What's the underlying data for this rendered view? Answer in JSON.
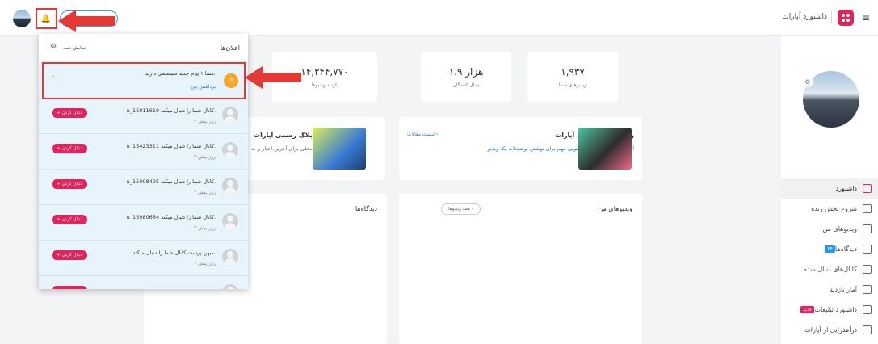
{
  "header": {
    "brand_title": "داشبورد آپارات",
    "menu_icon": "hamburger-icon",
    "logo_icon": "aparat-logo-icon",
    "bell_icon": "bell-icon"
  },
  "stats": [
    {
      "value": "۱,۹۳۷",
      "label": "ویدیوهای شما",
      "icon": "video-icon"
    },
    {
      "value": "۱.۹ هزار",
      "label": "دنبال کنندگان",
      "icon": "users-icon"
    },
    {
      "value": "۱۴,۲۴۴,۷۷۰",
      "label": "بازدید ویدیوها",
      "icon": "views-icon"
    }
  ],
  "blogs": [
    {
      "title": "وبلاگ تیم محصول آپارات",
      "desc": "آخرین مطلب: چند نکته ستونی مهم برای نوشتن توضیحات یک ویدیو",
      "link": "لیست مقالات ›"
    },
    {
      "title": "بلاگ رسمی آپارات",
      "desc": "محلی برای آخرین اخبار و ت"
    }
  ],
  "panels": {
    "my_videos_title": "ویدیوهای من",
    "all_videos_chip": "همه ویدیوها ›",
    "comments_title": "دیدگاه‌ها"
  },
  "sidebar": {
    "items": [
      {
        "label": "داشبورد",
        "active": true
      },
      {
        "label": "شروع پخش زنده"
      },
      {
        "label": "ویدیوهای من"
      },
      {
        "label": "دیدگاه‌ها",
        "badge": "۲۴"
      },
      {
        "label": "کانال‌های دنبال شده"
      },
      {
        "label": "آمار بازدید"
      },
      {
        "label": "داشبورد تبلیغات",
        "badge": "جدید"
      },
      {
        "label": "درآمدزایی از آپارات"
      }
    ]
  },
  "notifications": {
    "title": "اعلان‌ها",
    "show_all": "نمایش همه",
    "system": {
      "text": "شما ۱ پیام جدید سیستمی دارید.",
      "action": "برداشتن پین"
    },
    "items": [
      {
        "text": "u_15911619 کانال شما را دنبال میکند.",
        "time": "۳ روز پیش",
        "button": "+ دنبال کردن"
      },
      {
        "text": "u_15423311 کانال شما را دنبال میکند.",
        "time": "۳ روز پیش",
        "button": "+ دنبال کردن"
      },
      {
        "text": "u_15098495 کانال شما را دنبال میکند.",
        "time": "۳ روز پیش",
        "button": "+ دنبال کردن"
      },
      {
        "text": "u_15980664 کانال شما را دنبال میکند.",
        "time": "۳ روز پیش",
        "button": "+ دنبال کردن"
      },
      {
        "text": "میهن پرست کانال شما را دنبال میکند.",
        "time": "۶ روز پیش",
        "button": "+ دنبال کردن"
      }
    ]
  },
  "colors": {
    "accent": "#e0245e",
    "highlight": "#e53935",
    "link": "#2a7ab8"
  }
}
